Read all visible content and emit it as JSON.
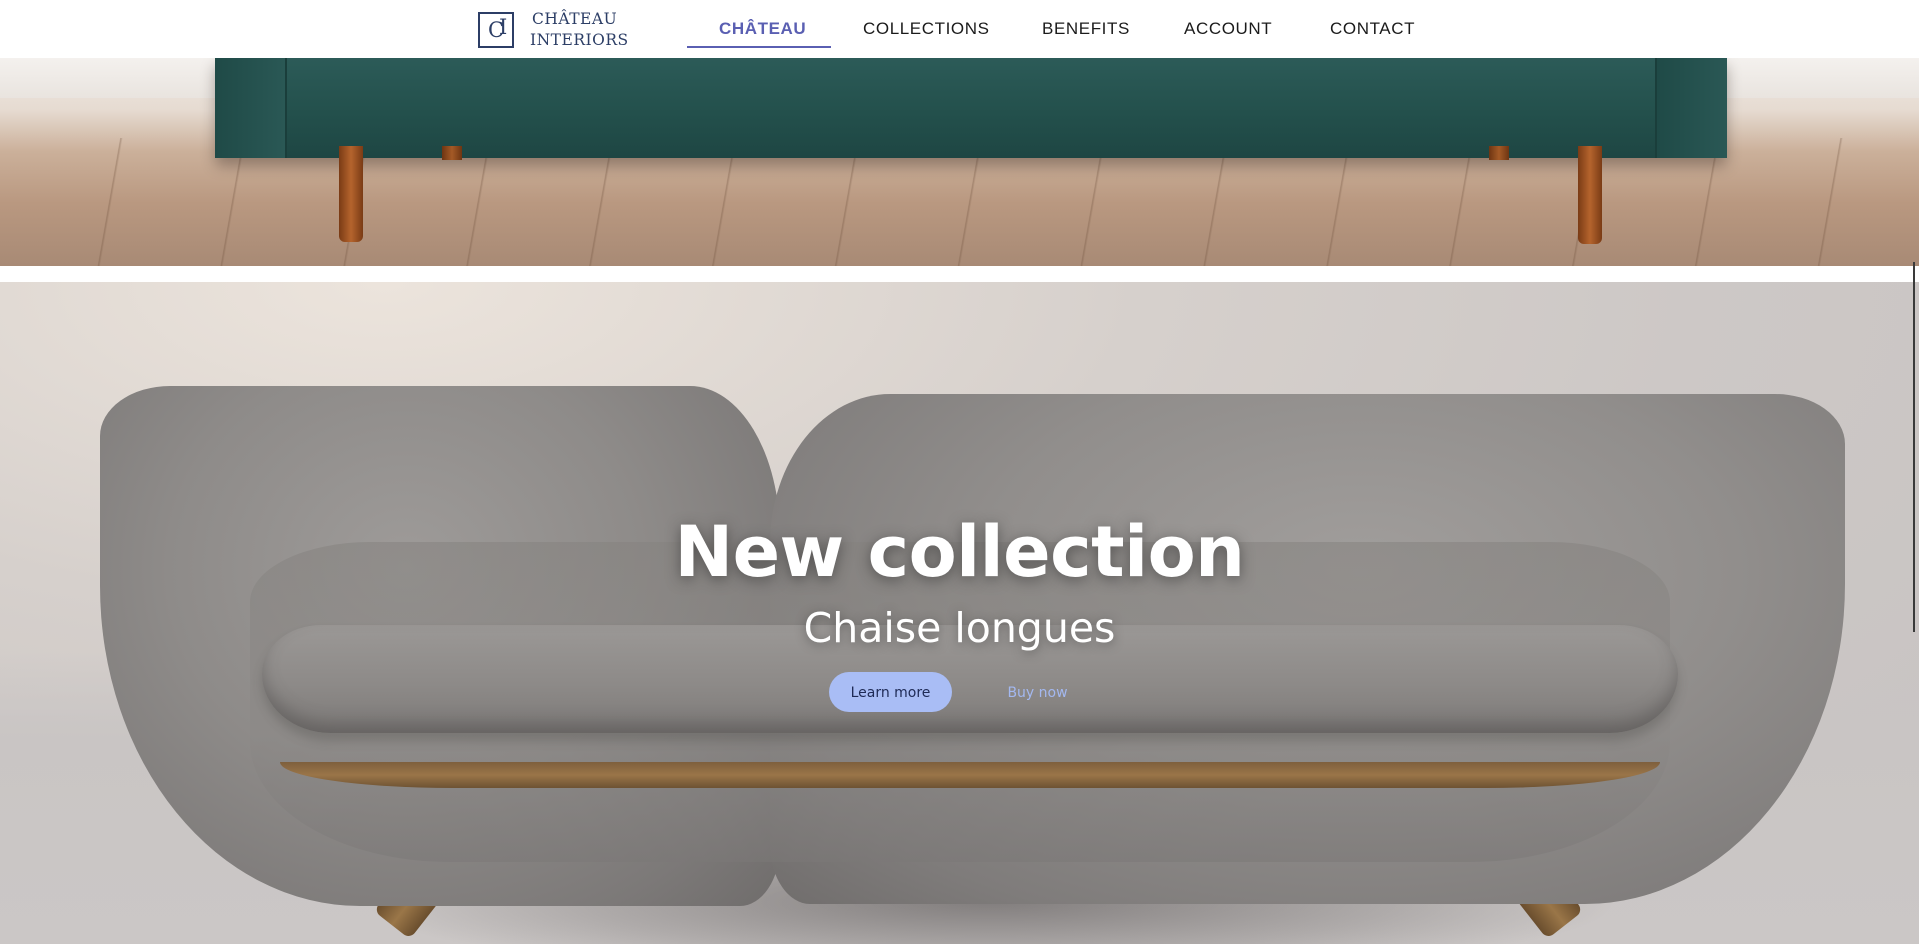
{
  "brand": {
    "name_line1": "CHÂTEAU",
    "name_line2": "INTERIORS",
    "mark_letter1": "C",
    "mark_letter2": "I"
  },
  "nav": {
    "items": [
      {
        "label": "CHÂTEAU",
        "active": true
      },
      {
        "label": "COLLECTIONS",
        "active": false
      },
      {
        "label": "BENEFITS",
        "active": false
      },
      {
        "label": "ACCOUNT",
        "active": false
      },
      {
        "label": "CONTACT",
        "active": false
      }
    ]
  },
  "hero": {
    "title": "New collection",
    "subtitle": "Chaise longues",
    "primary_button": "Learn more",
    "secondary_button": "Buy now"
  },
  "colors": {
    "accent": "#5a5fb2",
    "brand_navy": "#2c3e66",
    "button_bg": "#a9bdf5",
    "button_link": "#a3b8f0",
    "sofa_green": "#23504c"
  }
}
